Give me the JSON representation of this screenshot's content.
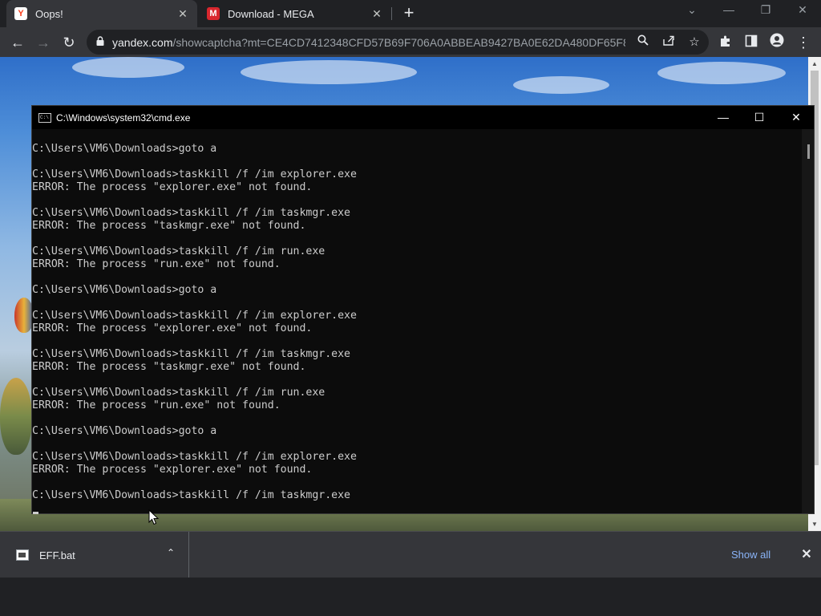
{
  "browser": {
    "tabs": [
      {
        "title": "Oops!",
        "favicon": "yandex-icon",
        "active": true
      },
      {
        "title": "Download - MEGA",
        "favicon": "mega-icon",
        "active": false
      }
    ],
    "new_tab_symbol": "+",
    "window_controls": {
      "dropdown": "⌄",
      "minimize": "—",
      "restore": "❐",
      "close": "✕"
    }
  },
  "toolbar": {
    "back": "←",
    "forward": "→",
    "reload": "↻",
    "lock": "🔒",
    "url_host": "yandex.com",
    "url_path": "/showcaptcha?mt=CE4CD7412348CFD57B69F706A0ABBEAB9427BA0E62DA480DF65F89E...",
    "search_icon": "🔍",
    "share_icon": "⇪",
    "bookmark_icon": "☆",
    "extensions_icon": "✱",
    "sidepanel_icon": "▣",
    "profile_icon": "●",
    "menu_icon": "⋮"
  },
  "cmd": {
    "title": "C:\\Windows\\system32\\cmd.exe",
    "icon_text": "C:\\",
    "buttons": {
      "minimize": "—",
      "maximize": "☐",
      "close": "✕"
    },
    "lines": [
      "C:\\Users\\VM6\\Downloads>goto a",
      "",
      "C:\\Users\\VM6\\Downloads>taskkill /f /im explorer.exe",
      "ERROR: The process \"explorer.exe\" not found.",
      "",
      "C:\\Users\\VM6\\Downloads>taskkill /f /im taskmgr.exe",
      "ERROR: The process \"taskmgr.exe\" not found.",
      "",
      "C:\\Users\\VM6\\Downloads>taskkill /f /im run.exe",
      "ERROR: The process \"run.exe\" not found.",
      "",
      "C:\\Users\\VM6\\Downloads>goto a",
      "",
      "C:\\Users\\VM6\\Downloads>taskkill /f /im explorer.exe",
      "ERROR: The process \"explorer.exe\" not found.",
      "",
      "C:\\Users\\VM6\\Downloads>taskkill /f /im taskmgr.exe",
      "ERROR: The process \"taskmgr.exe\" not found.",
      "",
      "C:\\Users\\VM6\\Downloads>taskkill /f /im run.exe",
      "ERROR: The process \"run.exe\" not found.",
      "",
      "C:\\Users\\VM6\\Downloads>goto a",
      "",
      "C:\\Users\\VM6\\Downloads>taskkill /f /im explorer.exe",
      "ERROR: The process \"explorer.exe\" not found.",
      "",
      "C:\\Users\\VM6\\Downloads>taskkill /f /im taskmgr.exe"
    ]
  },
  "downloads": {
    "file_name": "EFF.bat",
    "chevron": "⌃",
    "show_all": "Show all",
    "close": "✕"
  },
  "colors": {
    "chrome_dark": "#202124",
    "chrome_toolbar": "#35363a",
    "cmd_bg": "#0c0c0c",
    "cmd_text": "#cccccc",
    "link_blue": "#8ab4f8"
  }
}
